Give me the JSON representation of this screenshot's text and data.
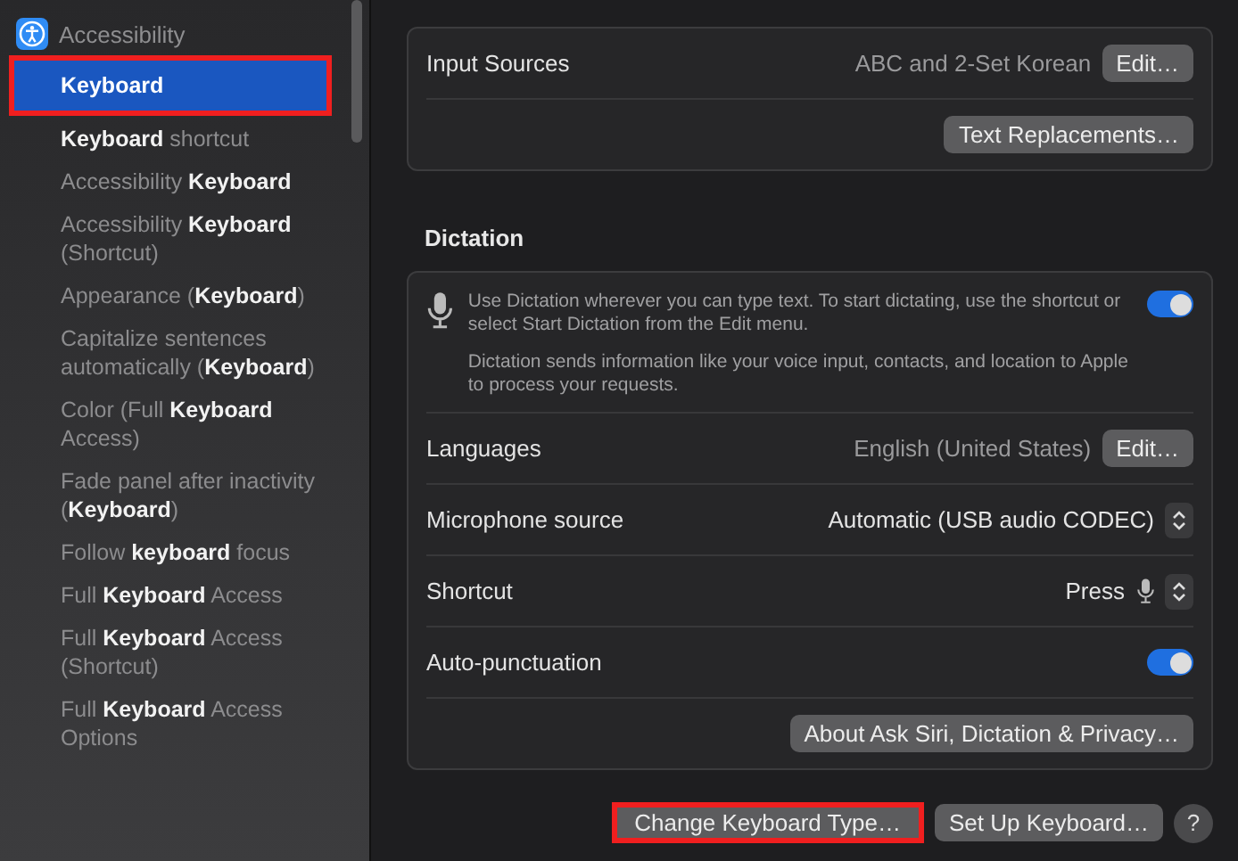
{
  "sidebar": {
    "header": {
      "label": "Accessibility"
    },
    "items": [
      {
        "label": "Keyboard",
        "selected": true,
        "highlighted": true
      },
      {
        "label": "**Keyboard** shortcut",
        "selected": false,
        "highlighted": false
      },
      {
        "label": "Accessibility **Keyboard**",
        "selected": false,
        "highlighted": false
      },
      {
        "label": "Accessibility **Keyboard** (Shortcut)",
        "selected": false,
        "highlighted": false
      },
      {
        "label": "Appearance (**Keyboard**)",
        "selected": false,
        "highlighted": false
      },
      {
        "label": "Capitalize sentences automatically (**Keyboard**)",
        "selected": false,
        "highlighted": false
      },
      {
        "label": "Color (Full **Keyboard** Access)",
        "selected": false,
        "highlighted": false
      },
      {
        "label": "Fade panel after inactivity (**Keyboard**)",
        "selected": false,
        "highlighted": false
      },
      {
        "label": "Follow **keyboard** focus",
        "selected": false,
        "highlighted": false
      },
      {
        "label": "Full **Keyboard** Access",
        "selected": false,
        "highlighted": false
      },
      {
        "label": "Full **Keyboard** Access (Shortcut)",
        "selected": false,
        "highlighted": false
      },
      {
        "label": "Full **Keyboard** Access Options",
        "selected": false,
        "highlighted": false
      }
    ]
  },
  "text_input": {
    "rows": [
      {
        "kind": "value-button",
        "label": "Input Sources",
        "value": "ABC and 2-Set Korean",
        "button": "Edit…"
      },
      {
        "kind": "button",
        "button": "Text Replacements…"
      }
    ]
  },
  "dictation": {
    "title": "Dictation",
    "intro": {
      "text": "Use Dictation wherever you can type text. To start dictating, use the shortcut or select Start Dictation from the Edit menu.",
      "note": "Dictation sends information like your voice input, contacts, and location to Apple to process your requests.",
      "on": true
    },
    "rows": [
      {
        "kind": "value-button",
        "label": "Languages",
        "value": "English (United States)",
        "button": "Edit…"
      },
      {
        "kind": "popup",
        "label": "Microphone source",
        "value": "Automatic (USB audio CODEC)"
      },
      {
        "kind": "shortcut",
        "label": "Shortcut",
        "value": "Press"
      },
      {
        "kind": "toggle",
        "label": "Auto-punctuation",
        "on": true
      },
      {
        "kind": "button",
        "button": "About Ask Siri, Dictation & Privacy…"
      }
    ]
  },
  "footer": {
    "buttons": [
      {
        "label": "Change Keyboard Type…",
        "highlighted": true
      },
      {
        "label": "Set Up Keyboard…",
        "highlighted": false
      }
    ],
    "help": "?"
  }
}
